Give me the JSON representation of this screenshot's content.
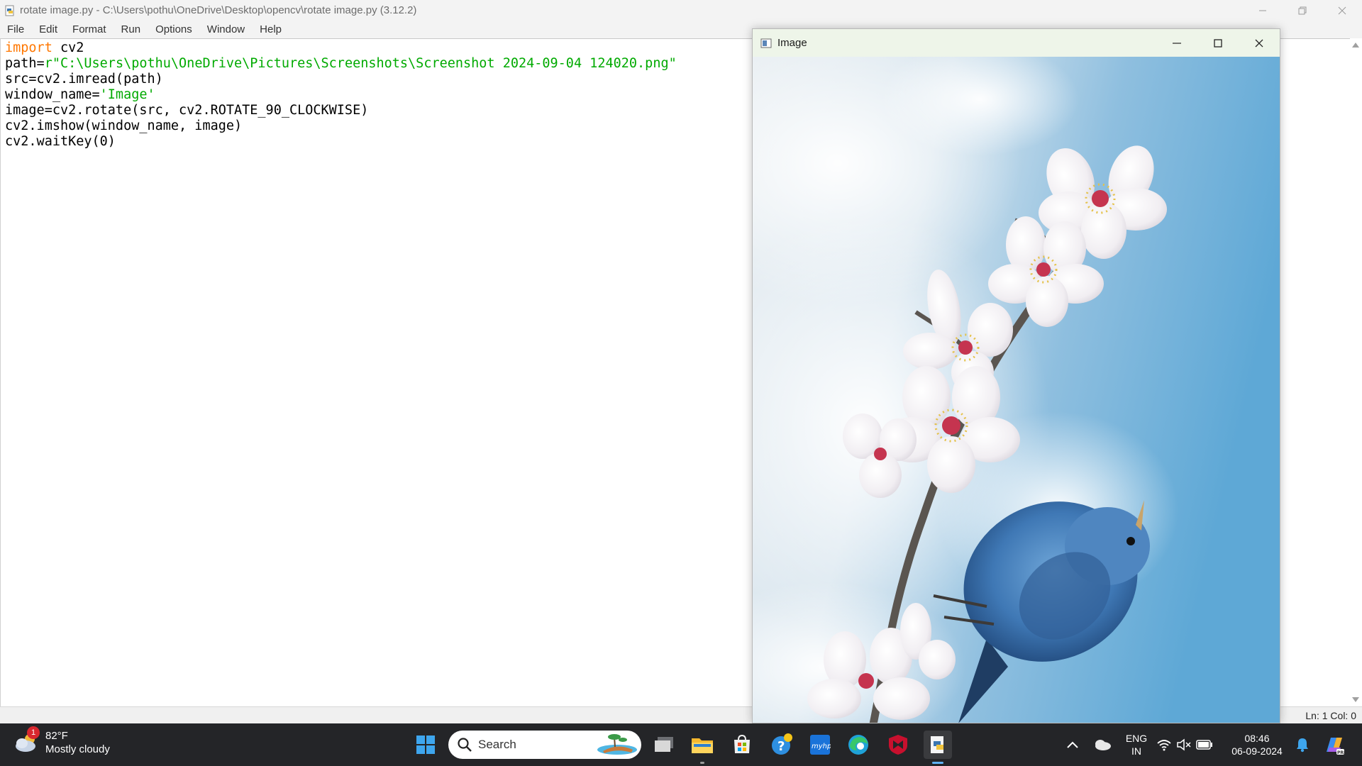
{
  "window": {
    "title": "rotate image.py - C:\\Users\\pothu\\OneDrive\\Desktop\\opencv\\rotate image.py (3.12.2)"
  },
  "menu": [
    "File",
    "Edit",
    "Format",
    "Run",
    "Options",
    "Window",
    "Help"
  ],
  "code": {
    "line1_kw": "import",
    "line1_rest": " cv2",
    "line2_pre": "path=",
    "line2_str": "r\"C:\\Users\\pothu\\OneDrive\\Pictures\\Screenshots\\Screenshot 2024-09-04 124020.png\"",
    "line3": "src=cv2.imread(path)",
    "line4_pre": "window_name=",
    "line4_str": "'Image'",
    "line5": "image=cv2.rotate(src, cv2.ROTATE_90_CLOCKWISE)",
    "line6": "cv2.imshow(window_name, image)",
    "line7": "cv2.waitKey(0)"
  },
  "status": {
    "position": "Ln: 1   Col: 0"
  },
  "image_window": {
    "title": "Image"
  },
  "taskbar": {
    "weather_badge": "1",
    "temperature": "82°F",
    "condition": "Mostly cloudy",
    "search_placeholder": "Search",
    "language_top": "ENG",
    "language_bottom": "IN",
    "time": "08:46",
    "date": "06-09-2024"
  }
}
